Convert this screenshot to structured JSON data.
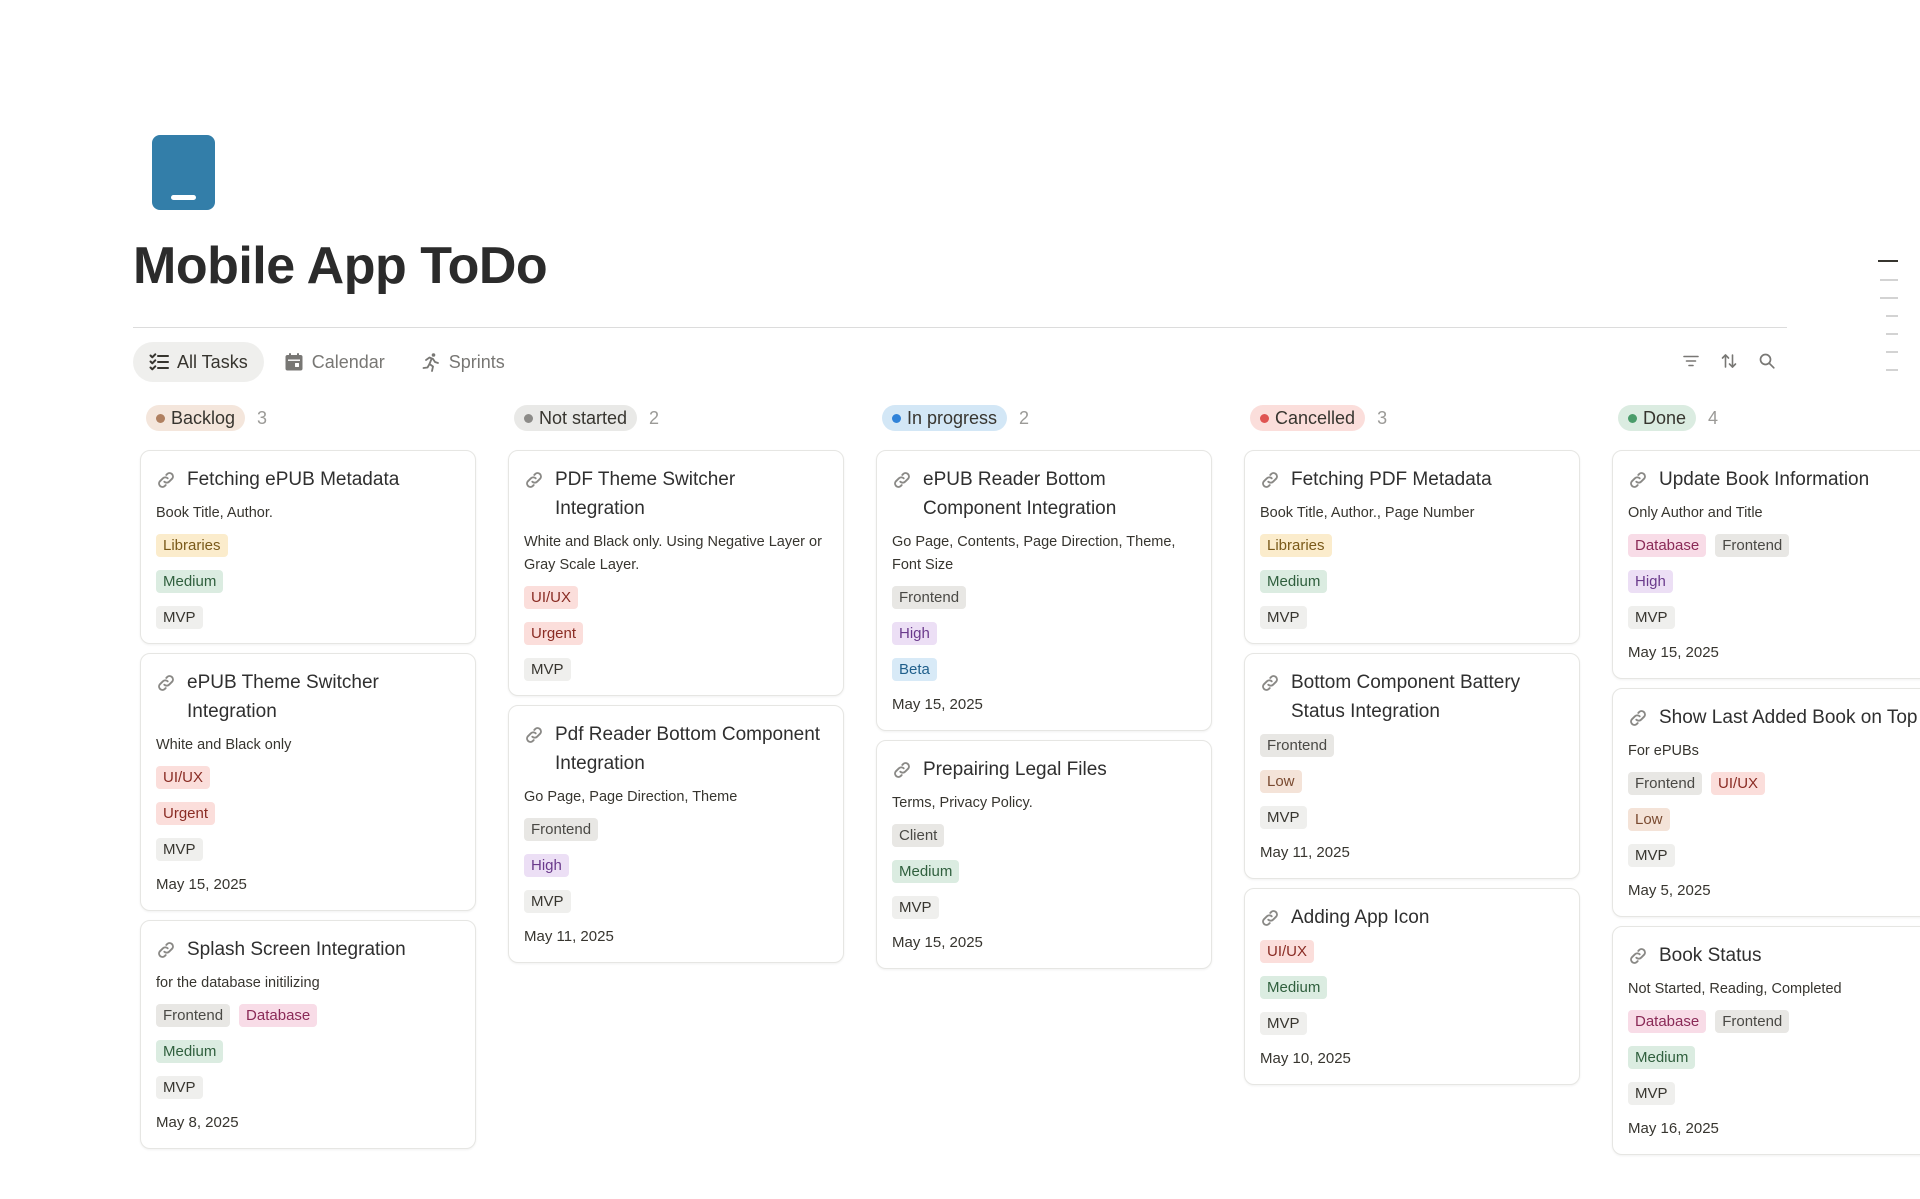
{
  "page": {
    "title": "Mobile App ToDo",
    "icon": "mobile-phone-icon",
    "icon_color": "#337ea9"
  },
  "views": [
    {
      "label": "All Tasks",
      "icon": "checklist-icon",
      "active": true
    },
    {
      "label": "Calendar",
      "icon": "calendar-icon",
      "active": false
    },
    {
      "label": "Sprints",
      "icon": "running-person-icon",
      "active": false
    }
  ],
  "toolbar": [
    "filter-icon",
    "sort-icon",
    "search-icon"
  ],
  "tag_colors": {
    "Libraries": {
      "bg": "#fbeccc",
      "fg": "#7a5a1a"
    },
    "Medium": {
      "bg": "#dbece1",
      "fg": "#2f5f3d"
    },
    "MVP": {
      "bg": "#efefed",
      "fg": "#37352f"
    },
    "UI/UX": {
      "bg": "#fbdedb",
      "fg": "#8a2c24"
    },
    "Urgent": {
      "bg": "#fbdedb",
      "fg": "#8a2c24"
    },
    "Frontend": {
      "bg": "#e8e7e4",
      "fg": "#4a4945"
    },
    "Database": {
      "bg": "#f8dce7",
      "fg": "#8a2a57"
    },
    "High": {
      "bg": "#ecdff5",
      "fg": "#6a3a8c"
    },
    "Beta": {
      "bg": "#d8eaf7",
      "fg": "#1f5f8b"
    },
    "Client": {
      "bg": "#e8e7e4",
      "fg": "#4a4945"
    },
    "Low": {
      "bg": "#f4e3d8",
      "fg": "#7a4a30"
    }
  },
  "columns": [
    {
      "name": "Backlog",
      "count": "3",
      "pill_bg": "#f4e6dc",
      "dot": "#b08060",
      "cards": [
        {
          "title": "Fetching ePUB Metadata",
          "desc": "Book Title, Author.",
          "tag_rows": [
            [
              "Libraries"
            ],
            [
              "Medium"
            ],
            [
              "MVP"
            ]
          ],
          "date": ""
        },
        {
          "title": "ePUB Theme Switcher Integration",
          "desc": "White and Black only",
          "tag_rows": [
            [
              "UI/UX"
            ],
            [
              "Urgent"
            ],
            [
              "MVP"
            ]
          ],
          "date": "May 15, 2025"
        },
        {
          "title": "Splash Screen Integration",
          "desc": "for the database initilizing",
          "tag_rows": [
            [
              "Frontend",
              "Database"
            ],
            [
              "Medium"
            ],
            [
              "MVP"
            ]
          ],
          "date": "May 8, 2025"
        }
      ]
    },
    {
      "name": "Not started",
      "count": "2",
      "pill_bg": "#e9e9e7",
      "dot": "#8c8b88",
      "cards": [
        {
          "title": "PDF Theme Switcher Integration",
          "desc": "White and Black only. Using Negative Layer or Gray Scale Layer.",
          "tag_rows": [
            [
              "UI/UX"
            ],
            [
              "Urgent"
            ],
            [
              "MVP"
            ]
          ],
          "date": ""
        },
        {
          "title": "Pdf Reader Bottom Component Integration",
          "desc": "Go Page, Page Direction, Theme",
          "tag_rows": [
            [
              "Frontend"
            ],
            [
              "High"
            ],
            [
              "MVP"
            ]
          ],
          "date": "May 11, 2025"
        }
      ]
    },
    {
      "name": "In progress",
      "count": "2",
      "pill_bg": "#d3e7f6",
      "dot": "#2f82d8",
      "cards": [
        {
          "title": "ePUB Reader Bottom Component Integration",
          "desc": "Go Page, Contents, Page Direction, Theme, Font Size",
          "tag_rows": [
            [
              "Frontend"
            ],
            [
              "High"
            ],
            [
              "Beta"
            ]
          ],
          "date": "May 15, 2025"
        },
        {
          "title": "Prepairing Legal Files",
          "desc": "Terms, Privacy Policy.",
          "tag_rows": [
            [
              "Client"
            ],
            [
              "Medium"
            ],
            [
              "MVP"
            ]
          ],
          "date": "May 15, 2025"
        }
      ]
    },
    {
      "name": "Cancelled",
      "count": "3",
      "pill_bg": "#fbdedb",
      "dot": "#df5452",
      "cards": [
        {
          "title": "Fetching PDF Metadata",
          "desc": "Book Title, Author., Page Number",
          "tag_rows": [
            [
              "Libraries"
            ],
            [
              "Medium"
            ],
            [
              "MVP"
            ]
          ],
          "date": ""
        },
        {
          "title": "Bottom Component Battery Status Integration",
          "desc": "",
          "tag_rows": [
            [
              "Frontend"
            ],
            [
              "Low"
            ],
            [
              "MVP"
            ]
          ],
          "date": "May 11, 2025"
        },
        {
          "title": "Adding App Icon",
          "desc": "",
          "tag_rows": [
            [
              "UI/UX"
            ],
            [
              "Medium"
            ],
            [
              "MVP"
            ]
          ],
          "date": "May 10, 2025"
        }
      ]
    },
    {
      "name": "Done",
      "count": "4",
      "pill_bg": "#dbece1",
      "dot": "#4a9c6a",
      "cards": [
        {
          "title": "Update Book Information",
          "desc": "Only Author and Title",
          "tag_rows": [
            [
              "Database",
              "Frontend"
            ],
            [
              "High"
            ],
            [
              "MVP"
            ]
          ],
          "date": "May 15, 2025"
        },
        {
          "title": "Show Last Added Book on Top",
          "desc": "For ePUBs",
          "tag_rows": [
            [
              "Frontend",
              "UI/UX"
            ],
            [
              "Low"
            ],
            [
              "MVP"
            ]
          ],
          "date": "May 5, 2025"
        },
        {
          "title": "Book Status",
          "desc": "Not Started, Reading, Completed",
          "tag_rows": [
            [
              "Database",
              "Frontend"
            ],
            [
              "Medium"
            ],
            [
              "MVP"
            ]
          ],
          "date": "May 16, 2025"
        }
      ]
    }
  ]
}
